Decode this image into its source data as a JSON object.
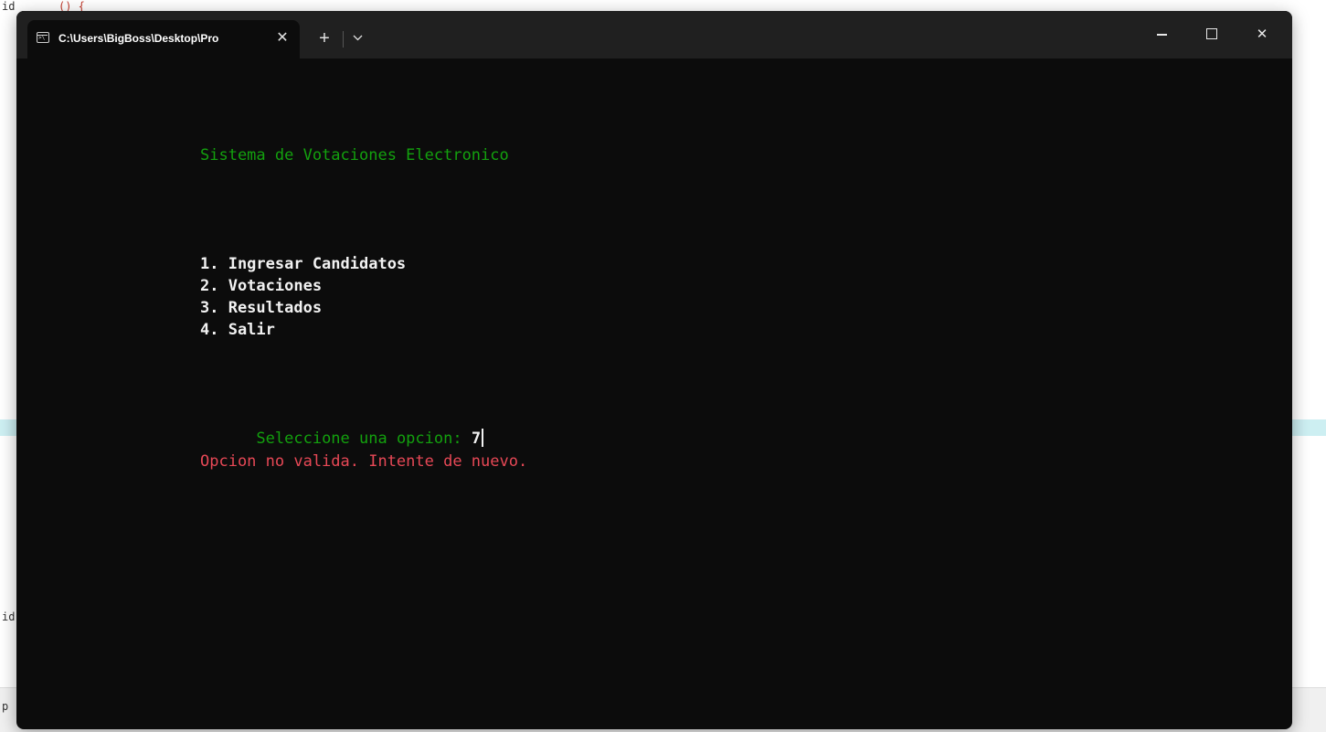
{
  "window": {
    "tab_title": "C:\\Users\\BigBoss\\Desktop\\Pro",
    "tab_close": "✕",
    "new_tab": "+",
    "dropdown": "⌄",
    "minimize": "",
    "maximize": "",
    "close": "✕",
    "icon": "terminal-icon"
  },
  "console": {
    "title": "Sistema de Votaciones Electronico",
    "menu": [
      "1. Ingresar Candidatos",
      "2. Votaciones",
      "3. Resultados",
      "4. Salir"
    ],
    "prompt": "Seleccione una opcion: ",
    "input_value": "7",
    "error": "Opcion no valida. Intente de nuevo."
  },
  "background": {
    "fragment_top": "id",
    "fragment_top_red": "() {",
    "fragment_mid": "id",
    "fragment_bottom": "p"
  },
  "colors": {
    "console_bg": "#0c0c0c",
    "prompt_green": "#13a10e",
    "menu_white": "#f2f2f2",
    "error_red": "#e74856",
    "titlebar": "#202020"
  }
}
